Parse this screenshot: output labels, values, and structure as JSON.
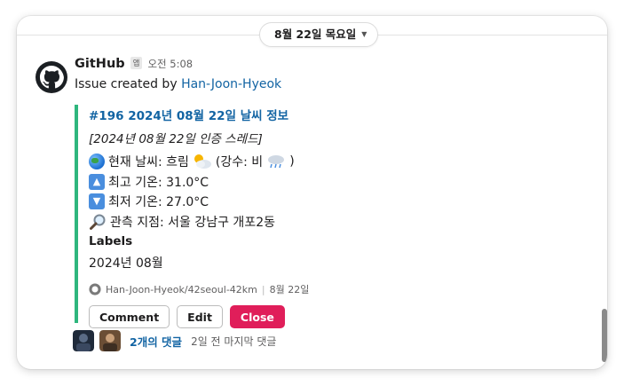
{
  "date_divider": {
    "label": "8월 22일 목요일"
  },
  "message": {
    "sender": "GitHub",
    "app_badge": "앱",
    "time": "오전 5:08",
    "created_prefix": "Issue created by ",
    "created_user": "Han-Joon-Hyeok"
  },
  "attachment": {
    "accent_color": "#2eb67d",
    "title": "#196 2024년 08월 22일 날씨 정보",
    "subtitle": "[2024년 08월 22일 인증 스레드]",
    "lines": [
      {
        "icon": "globe-icon",
        "text": "현재 날씨: 흐림",
        "extra_open": "(강수: 비",
        "extra_close": ")"
      },
      {
        "icon": "up-arrow-icon",
        "text": "최고 기온: 31.0°C"
      },
      {
        "icon": "down-arrow-icon",
        "text": "최저 기온: 27.0°C"
      },
      {
        "icon": "magnifier-icon",
        "text": "관측 지점: 서울 강남구 개포2동"
      }
    ],
    "labels_heading": "Labels",
    "labels_value": "2024년 08월",
    "footer_repo": "Han-Joon-Hyeok/42seoul-42km",
    "footer_sep": "|",
    "footer_date": "8월 22일",
    "buttons": {
      "comment": "Comment",
      "edit": "Edit",
      "close": "Close"
    }
  },
  "replies": {
    "count_label": "2개의 댓글",
    "last_label": "2일 전 마지막 댓글"
  },
  "colors": {
    "link": "#1264a3",
    "danger": "#e01e5a",
    "accent": "#2eb67d"
  }
}
